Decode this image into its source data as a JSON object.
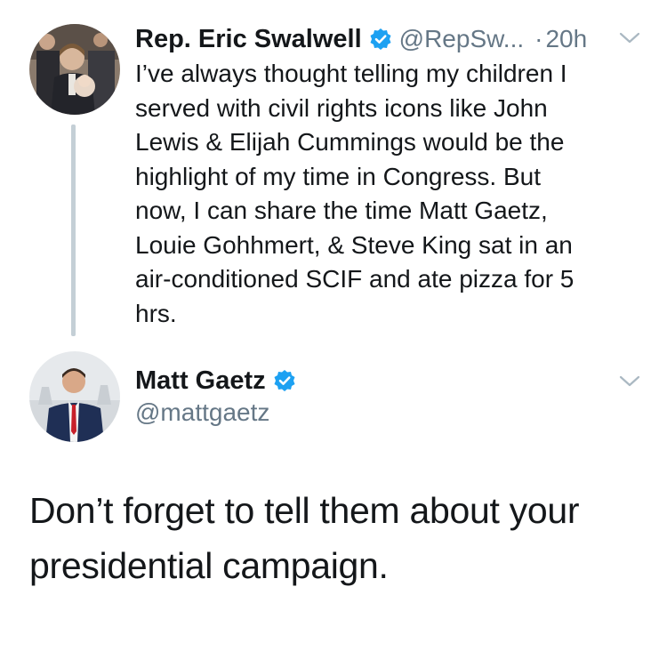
{
  "colors": {
    "text": "#14171a",
    "secondary": "#657786",
    "verified": "#1da1f2",
    "thread_line": "#c4cfd6"
  },
  "original_tweet": {
    "display_name": "Rep. Eric Swalwell",
    "verified": true,
    "handle": "@RepSw...",
    "separator": "·",
    "time": "20h",
    "text": "I’ve always thought telling my children I\nserved with civil rights icons like John\nLewis & Elijah Cummings would be the\nhighlight of my time in Congress. But\nnow, I can share the time Matt Gaetz,\nLouie Gohhmert, & Steve King sat in an\nair-conditioned SCIF and ate pizza for 5\nhrs.",
    "menu_icon": "chevron-down-icon"
  },
  "reply_tweet": {
    "display_name": "Matt Gaetz",
    "verified": true,
    "handle": "@mattgaetz",
    "text": "Don’t forget to tell them about your\npresidential campaign.",
    "menu_icon": "chevron-down-icon"
  }
}
